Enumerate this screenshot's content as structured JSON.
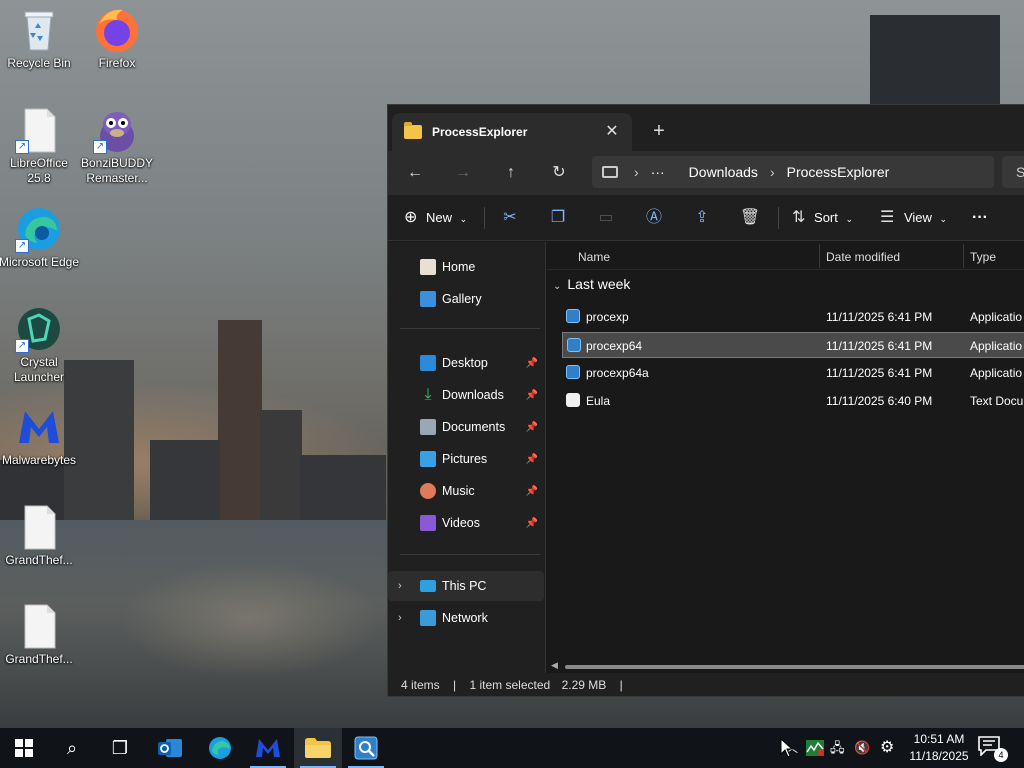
{
  "desktop": {
    "icons": [
      {
        "label": "Recycle Bin"
      },
      {
        "label": "Firefox"
      },
      {
        "label": "LibreOffice 25.8"
      },
      {
        "label": "BonziBUDDY Remaster..."
      },
      {
        "label": "Microsoft Edge"
      },
      {
        "label": "Crystal Launcher"
      },
      {
        "label": "Malwarebytes"
      },
      {
        "label": "GrandThef..."
      },
      {
        "label": "GrandThef..."
      }
    ]
  },
  "explorer": {
    "tab_title": "ProcessExplorer",
    "tab_close": "✕",
    "new_tab": "+",
    "nav": {
      "back": "←",
      "forward": "→",
      "up": "↑",
      "refresh": "↻"
    },
    "address": {
      "ellipsis": "···",
      "segments": [
        "Downloads",
        "ProcessExplorer"
      ]
    },
    "search_placeholder": "S",
    "commands": {
      "new": "New",
      "sort": "Sort",
      "view": "View",
      "more": "···"
    },
    "sidebar": {
      "items": [
        {
          "label": "Home",
          "icon": "home-icon"
        },
        {
          "label": "Gallery",
          "icon": "gallery-icon"
        },
        {
          "label": "Desktop",
          "icon": "desktop-icon",
          "pinned": true
        },
        {
          "label": "Downloads",
          "icon": "downloads-icon",
          "pinned": true
        },
        {
          "label": "Documents",
          "icon": "documents-icon",
          "pinned": true
        },
        {
          "label": "Pictures",
          "icon": "pictures-icon",
          "pinned": true
        },
        {
          "label": "Music",
          "icon": "music-icon",
          "pinned": true
        },
        {
          "label": "Videos",
          "icon": "videos-icon",
          "pinned": true
        },
        {
          "label": "This PC",
          "icon": "this-pc-icon"
        },
        {
          "label": "Network",
          "icon": "network-icon"
        }
      ]
    },
    "columns": {
      "name": "Name",
      "date": "Date modified",
      "type": "Type"
    },
    "group_label": "Last week",
    "files": [
      {
        "name": "procexp",
        "date": "11/11/2025 6:41 PM",
        "type": "Applicatio",
        "kind": "app"
      },
      {
        "name": "procexp64",
        "date": "11/11/2025 6:41 PM",
        "type": "Applicatio",
        "kind": "app",
        "selected": true
      },
      {
        "name": "procexp64a",
        "date": "11/11/2025 6:41 PM",
        "type": "Applicatio",
        "kind": "app"
      },
      {
        "name": "Eula",
        "date": "11/11/2025 6:40 PM",
        "type": "Text Docu",
        "kind": "text"
      }
    ],
    "status": {
      "count": "4 items",
      "selection": "1 item selected",
      "size": "2.29 MB"
    }
  },
  "taskbar": {
    "clock_time": "10:51 AM",
    "clock_date": "11/18/2025",
    "notification_count": "4"
  },
  "colors": {
    "accent": "#7ab8ff",
    "window_bg": "#191919",
    "taskbar_bg": "#101418",
    "folder": "#f3c44a"
  }
}
